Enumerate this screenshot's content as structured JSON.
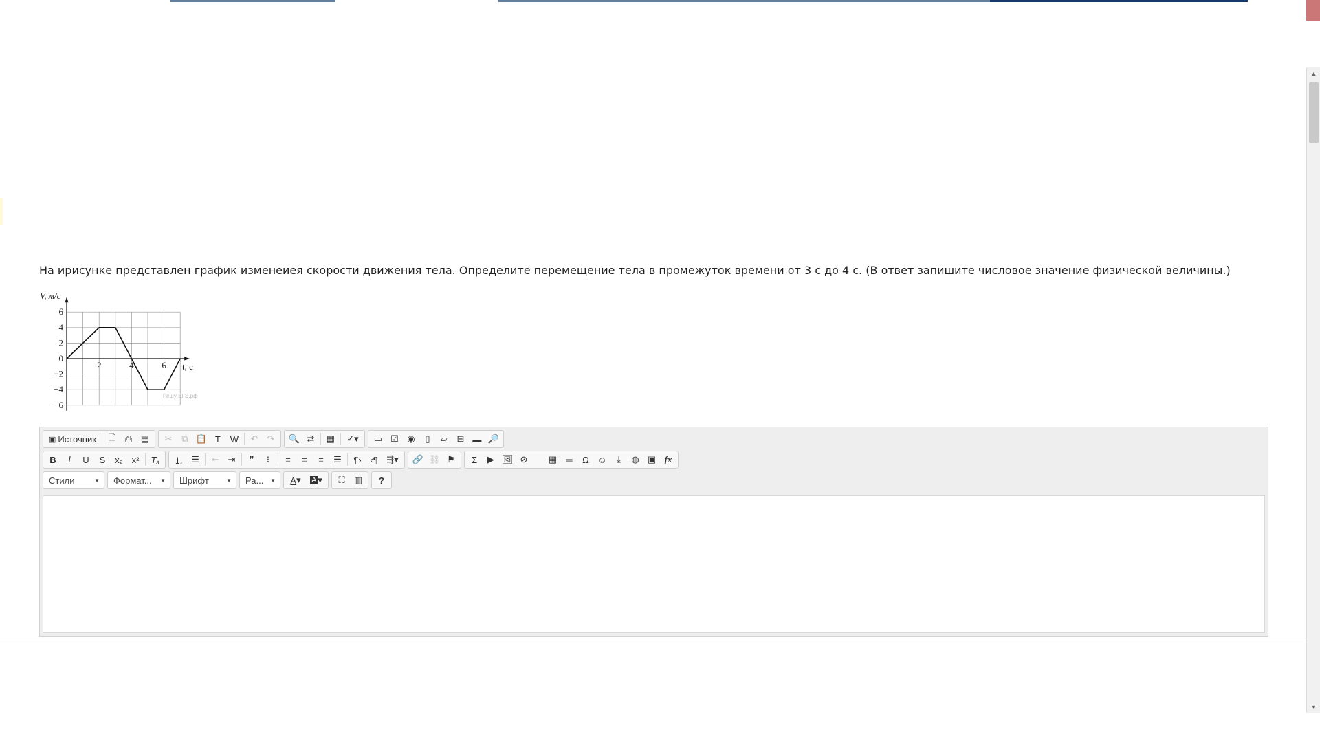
{
  "question": {
    "text": "На ирисунке представлен график изменеиея скорости движения тела. Определите перемещение тела в промежуток времени от 3 с до 4 с. (В ответ запишите числовое значение физической величины.)"
  },
  "chart_data": {
    "type": "line",
    "xlabel": "t, c",
    "ylabel": "V, м/с",
    "xlim": [
      0,
      7
    ],
    "ylim": [
      -6,
      6
    ],
    "x_tick_labels": [
      "2",
      "4",
      "6"
    ],
    "y_tick_labels": [
      "6",
      "4",
      "2",
      "0",
      "−2",
      "−4",
      "−6"
    ],
    "grid": true,
    "watermark": "Решу ЕГЭ.рф",
    "series": [
      {
        "x": [
          0,
          2,
          3,
          4,
          5,
          6,
          7
        ],
        "y": [
          0,
          4,
          4,
          0,
          -4,
          -4,
          0
        ]
      }
    ]
  },
  "editor": {
    "toolbar1": {
      "source_label": "Источник"
    },
    "combos": {
      "styles": "Стили",
      "format": "Формат...",
      "font": "Шрифт",
      "size": "Ра..."
    },
    "help": "?"
  }
}
